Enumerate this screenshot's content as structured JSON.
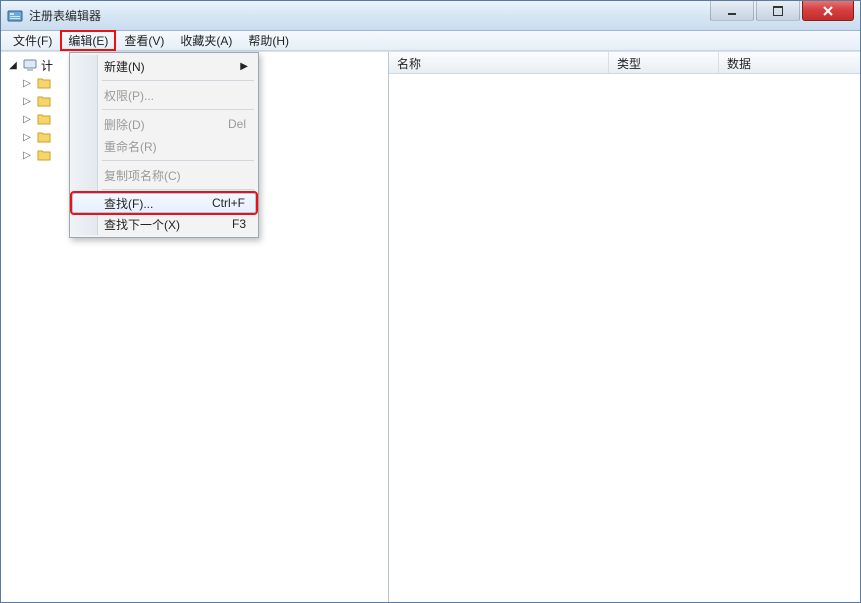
{
  "window": {
    "title": "注册表编辑器"
  },
  "menubar": {
    "file": "文件(F)",
    "edit": "编辑(E)",
    "view": "查看(V)",
    "fav": "收藏夹(A)",
    "help": "帮助(H)"
  },
  "edit_menu": {
    "new": {
      "label": "新建(N)",
      "has_submenu": true
    },
    "perm": {
      "label": "权限(P)..."
    },
    "delete": {
      "label": "删除(D)",
      "shortcut": "Del"
    },
    "rename": {
      "label": "重命名(R)"
    },
    "copy": {
      "label": "复制项名称(C)"
    },
    "find": {
      "label": "查找(F)...",
      "shortcut": "Ctrl+F"
    },
    "findnext": {
      "label": "查找下一个(X)",
      "shortcut": "F3"
    }
  },
  "tree": {
    "root": "计",
    "children": [
      "",
      "",
      "",
      "",
      ""
    ]
  },
  "list": {
    "columns": {
      "name": "名称",
      "type": "类型",
      "data": "数据"
    }
  }
}
